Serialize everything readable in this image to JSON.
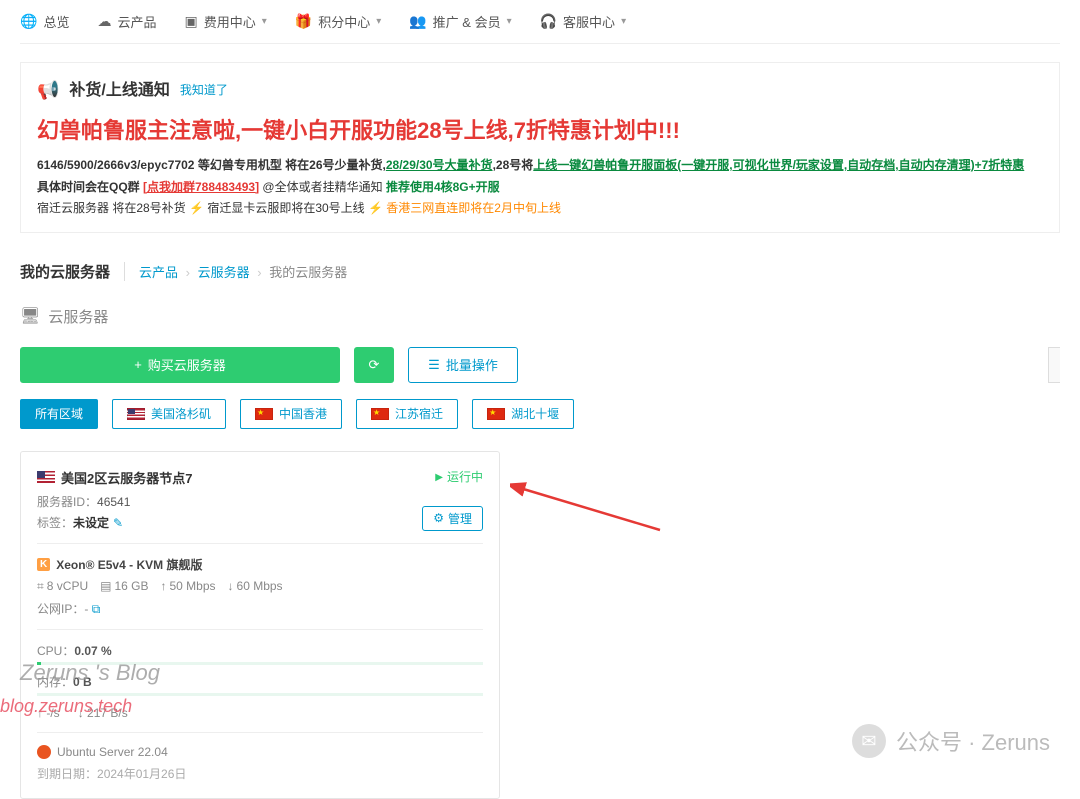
{
  "nav": {
    "overview": "总览",
    "products": "云产品",
    "billing": "费用中心",
    "points": "积分中心",
    "promo": "推广 & 会员",
    "support": "客服中心"
  },
  "notice": {
    "title": "补货/上线通知",
    "ack": "我知道了",
    "headline": "幻兽帕鲁服主注意啦,一键小白开服功能28号上线,7折特惠计划中!!!",
    "line1_a": "6146/5900/2666v3/epyc7702 等幻兽专用机型 将在26号少量补货,",
    "line1_b": "28/29/30号大量补货",
    "line1_c": ",28号将",
    "line1_d": "上线一键幻兽帕鲁开服面板(一键开服,可视化世界/玩家设置,自动存档,自动内存清理)+7折特惠",
    "line2_a": "具体时间会在QQ群 ",
    "line2_b": "[点我加群788483493]",
    "line2_c": " @全体或者挂精华通知 ",
    "line2_d": "推荐使用4核8G+开服",
    "line3_a": "宿迁云服务器 将在28号补货 ",
    "line3_b": " 宿迁显卡云服即将在30号上线 ",
    "line3_c": " 香港三网直连即将在2月中旬上线"
  },
  "page": {
    "title": "我的云服务器",
    "crumb1": "云产品",
    "crumb2": "云服务器",
    "crumb3": "我的云服务器"
  },
  "section": {
    "title": "云服务器"
  },
  "actions": {
    "buy": "购买云服务器",
    "batch": "批量操作"
  },
  "regions": {
    "all": "所有区域",
    "us": "美国洛杉矶",
    "hk": "中国香港",
    "sq": "江苏宿迁",
    "sy": "湖北十堰"
  },
  "server": {
    "name": "美国2区云服务器节点7",
    "status": "运行中",
    "id_label": "服务器ID：",
    "id": "46541",
    "tag_label": "标签：",
    "tag_value": "未设定",
    "manage": "管理",
    "spec_title": "Xeon® E5v4 - KVM 旗舰版",
    "vcpu": "8 vCPU",
    "ram": "16 GB",
    "up": "50 Mbps",
    "down": "60 Mbps",
    "ip_label": "公网IP：",
    "ip_value": "-",
    "cpu_label": "CPU：",
    "cpu_value": "0.07 %",
    "mem_label": "内存：",
    "mem_value": "0 B",
    "net_up": "-/s",
    "net_down": "217 B/s",
    "os": "Ubuntu Server 22.04",
    "expiry_label": "到期日期：",
    "expiry": "2024年01月26日"
  },
  "watermark": {
    "blog": "Zeruns 's Blog",
    "url": "blog.zeruns.tech",
    "wechat_label": "公众号 · Zeruns"
  }
}
